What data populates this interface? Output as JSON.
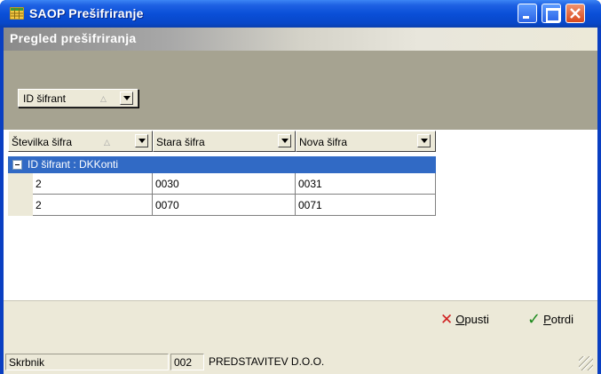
{
  "window": {
    "title": "SAOP Prešifriranje"
  },
  "header": {
    "title": "Pregled prešifriranja"
  },
  "group_by": {
    "chip_label": "ID šifrant"
  },
  "columns": [
    {
      "label": "Številka šifra"
    },
    {
      "label": "Stara šifra"
    },
    {
      "label": "Nova šifra"
    }
  ],
  "group_row": {
    "label": "ID šifrant : DKKonti"
  },
  "rows": [
    {
      "stevilka": "2",
      "stara": "0030",
      "nova": "0031"
    },
    {
      "stevilka": "2",
      "stara": "0070",
      "nova": "0071"
    }
  ],
  "buttons": {
    "cancel_underline": "O",
    "cancel_rest": "pusti",
    "confirm_underline": "P",
    "confirm_rest": "otrdi"
  },
  "status": {
    "role": "Skrbnik",
    "code": "002",
    "company": "PREDSTAVITEV D.O.O."
  },
  "colors": {
    "titlebar": "#0a4fd8",
    "selection": "#316ac5",
    "group_area": "#a6a391",
    "face": "#ece9d8"
  }
}
